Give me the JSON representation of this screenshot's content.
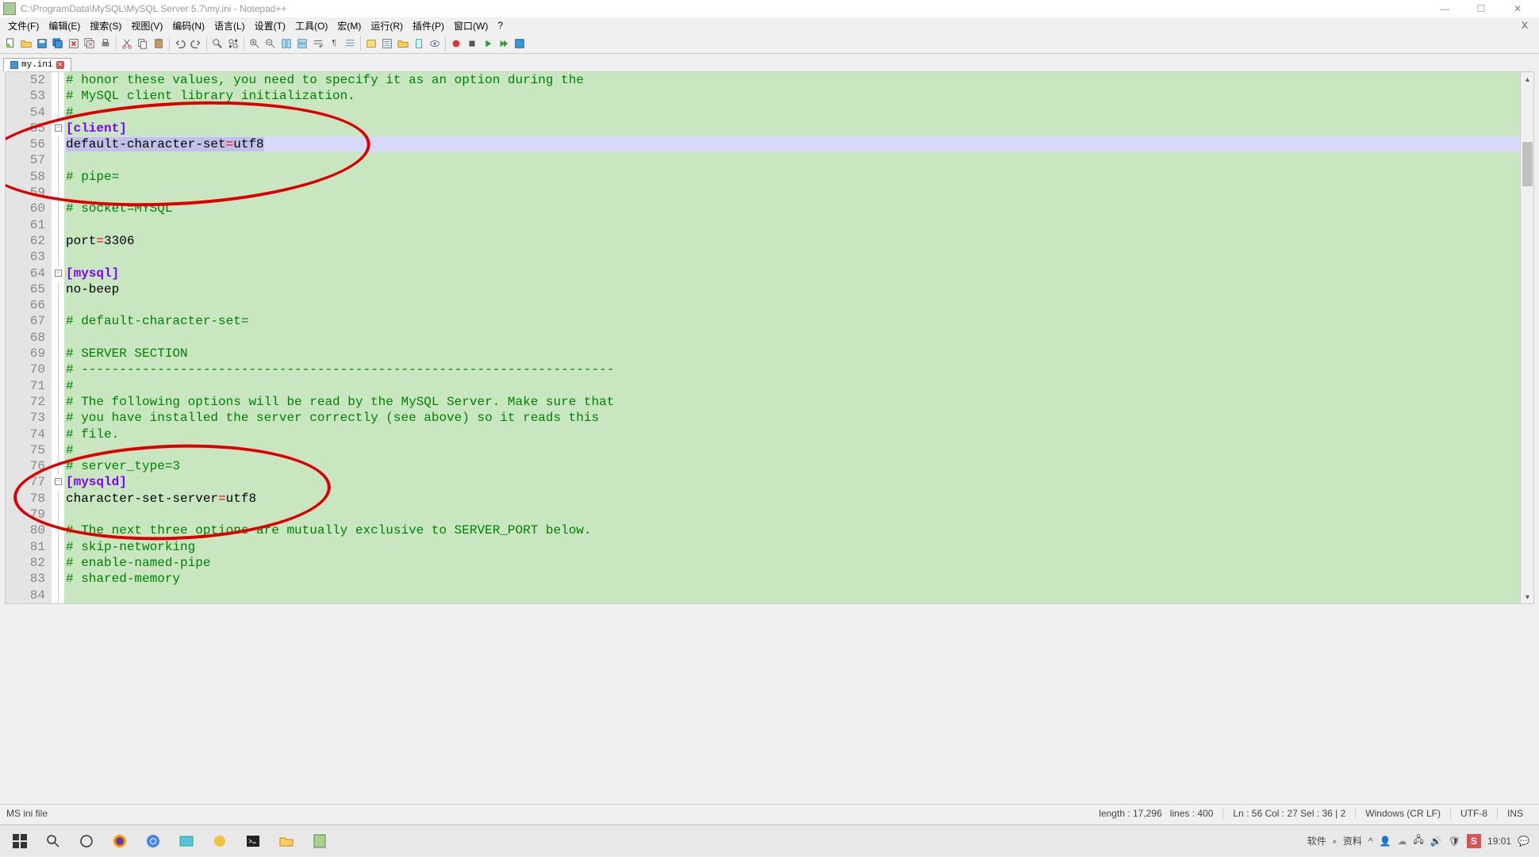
{
  "window": {
    "title": "C:\\ProgramData\\MySQL\\MySQL Server 5.7\\my.ini - Notepad++",
    "minimize": "—",
    "maximize": "☐",
    "close": "✕"
  },
  "menu": {
    "file": "文件(F)",
    "edit": "编辑(E)",
    "search": "搜索(S)",
    "view": "视图(V)",
    "encoding": "编码(N)",
    "language": "语言(L)",
    "settings": "设置(T)",
    "tools": "工具(O)",
    "macro": "宏(M)",
    "run": "运行(R)",
    "plugins": "插件(P)",
    "window": "窗口(W)",
    "help": "?",
    "mclose": "X"
  },
  "tab": {
    "name": "my.ini"
  },
  "code": {
    "lines": [
      {
        "n": 52,
        "t": "comment",
        "text": "# honor these values, you need to specify it as an option during the"
      },
      {
        "n": 53,
        "t": "comment",
        "text": "# MySQL client library initialization."
      },
      {
        "n": 54,
        "t": "comment",
        "text": "#"
      },
      {
        "n": 55,
        "t": "section",
        "text": "[client]",
        "fold": true
      },
      {
        "n": 56,
        "t": "kv",
        "key": "default-character-set",
        "val": "utf8",
        "sel": true
      },
      {
        "n": 57,
        "t": "blank",
        "text": ""
      },
      {
        "n": 58,
        "t": "comment",
        "text": "# pipe="
      },
      {
        "n": 59,
        "t": "blank",
        "text": ""
      },
      {
        "n": 60,
        "t": "comment",
        "text": "# socket=MYSQL"
      },
      {
        "n": 61,
        "t": "blank",
        "text": ""
      },
      {
        "n": 62,
        "t": "kv",
        "key": "port",
        "val": "3306"
      },
      {
        "n": 63,
        "t": "blank",
        "text": "",
        "caret": true
      },
      {
        "n": 64,
        "t": "section",
        "text": "[mysql]",
        "fold": true
      },
      {
        "n": 65,
        "t": "key",
        "text": "no-beep"
      },
      {
        "n": 66,
        "t": "blank",
        "text": ""
      },
      {
        "n": 67,
        "t": "comment",
        "text": "# default-character-set="
      },
      {
        "n": 68,
        "t": "blank",
        "text": ""
      },
      {
        "n": 69,
        "t": "comment",
        "text": "# SERVER SECTION"
      },
      {
        "n": 70,
        "t": "comment",
        "text": "# ----------------------------------------------------------------------"
      },
      {
        "n": 71,
        "t": "comment",
        "text": "#"
      },
      {
        "n": 72,
        "t": "comment",
        "text": "# The following options will be read by the MySQL Server. Make sure that"
      },
      {
        "n": 73,
        "t": "comment",
        "text": "# you have installed the server correctly (see above) so it reads this"
      },
      {
        "n": 74,
        "t": "comment",
        "text": "# file."
      },
      {
        "n": 75,
        "t": "comment",
        "text": "#"
      },
      {
        "n": 76,
        "t": "comment",
        "text": "# server_type=3"
      },
      {
        "n": 77,
        "t": "section",
        "text": "[mysqld]",
        "fold": true
      },
      {
        "n": 78,
        "t": "kv",
        "key": "character-set-server",
        "val": "utf8"
      },
      {
        "n": 79,
        "t": "blank",
        "text": ""
      },
      {
        "n": 80,
        "t": "comment",
        "text": "# The next three options are mutually exclusive to SERVER_PORT below."
      },
      {
        "n": 81,
        "t": "comment",
        "text": "# skip-networking"
      },
      {
        "n": 82,
        "t": "comment",
        "text": "# enable-named-pipe"
      },
      {
        "n": 83,
        "t": "comment",
        "text": "# shared-memory"
      },
      {
        "n": 84,
        "t": "blank",
        "text": ""
      }
    ]
  },
  "status": {
    "filetype": "MS ini file",
    "length_label": "length : 17,296",
    "lines_label": "lines : 400",
    "pos": "Ln : 56   Col : 27   Sel : 36 | 2",
    "eol": "Windows (CR LF)",
    "enc": "UTF-8",
    "ins": "INS"
  },
  "tray": {
    "txt1": "软件",
    "txt2": "资料",
    "ime": "S",
    "time": "19:01"
  }
}
